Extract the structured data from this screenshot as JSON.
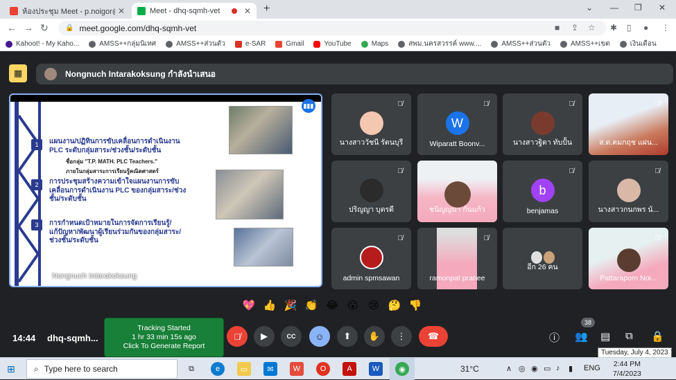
{
  "browser": {
    "tabs": [
      {
        "title": "ห้องประชุม Meet - p.noigor@gmail...",
        "active": false
      },
      {
        "title": "Meet - dhq-sqmh-vet",
        "active": true
      }
    ],
    "new_tab": "+",
    "url": "meet.google.com/dhq-sqmh-vet",
    "bookmarks": [
      "Kahoot! - My Kaho...",
      "AMSS++กลุ่มนิเทศ",
      "AMSS++ส่วนตัว",
      "e-SAR",
      "Gmail",
      "YouTube",
      "Maps",
      "สพม.นครสวรรค์ www....",
      "AMSS++ส่วนตัว",
      "AMSS++เขต",
      "เงินเดือน"
    ]
  },
  "meet": {
    "presenter_banner": "Nongnuch Intarakoksung กำลังนำเสนอ",
    "stage": {
      "name": "Nongnuch Intarakoksung",
      "slide": {
        "items": [
          {
            "num": "1",
            "text_line1": "แผนงาน/ปฏิทินการขับเคลื่อนการดำเนินงาน",
            "text_line2": "PLC ระดับกลุ่มสาระ/ช่วงชั้น/ระดับชั้น"
          },
          {
            "num": "2",
            "text_line1": "การประชุมสร้างความเข้าใจแผนงานการขับ",
            "text_line2": "เคลื่อนการดำเนินงาน PLC ของกลุ่มสาระ/ช่วง",
            "text_line3": "ชั้น/ระดับชั้น"
          },
          {
            "num": "3",
            "text_line1": "การกำหนดเป้าหมายในการจัดการเรียนรู้/",
            "text_line2": "แก้ปัญหา/พัฒนาผู้เรียนร่วมกันของกลุ่มสาระ/",
            "text_line3": "ช่วงชั้น/ระดับชั้น"
          }
        ],
        "sub1": "ชื่อกลุ่ม \"T.P. MATH. PLC Teachers.\"",
        "sub2": "ภายในกลุ่มสาระการเรียนรู้คณิตศาสตร์"
      }
    },
    "participants": [
      {
        "name": "นางสาววัชนี รัตนบุรี",
        "avatar": "photo"
      },
      {
        "name": "Wiparatt Boonv...",
        "avatar": "W",
        "color": "#1a73e8"
      },
      {
        "name": "นางสาวฐิดา ทับปั้น",
        "avatar": "photo"
      },
      {
        "name": "ส.ต.คมกฤช แผ่น...",
        "avatar": "video"
      },
      {
        "name": "ปริญญา บุตรดี",
        "avatar": "photo"
      },
      {
        "name": "ชนิญญนา กันแก้ว",
        "avatar": "video"
      },
      {
        "name": "benjamas",
        "avatar": "b",
        "color": "#a142f4"
      },
      {
        "name": "นางสาวกนกพร นั...",
        "avatar": "photo"
      },
      {
        "name": "admin spmsawan",
        "avatar": "photo"
      },
      {
        "name": "ramonpat pranee",
        "avatar": "video"
      },
      {
        "name": "อีก 26 คน",
        "avatar": "group"
      },
      {
        "name": "Pattaraporn Noi...",
        "avatar": "video"
      }
    ],
    "reactions": [
      "💖",
      "👍",
      "🎉",
      "👏",
      "😂",
      "😮",
      "😢",
      "🤔",
      "👎"
    ],
    "bottom": {
      "time": "14:44",
      "meeting_code": "dhq-sqmh...",
      "tracker_line1": "Tracking Started",
      "tracker_line2": "1 hr 33 min 15s ago",
      "tracker_line3": "Click To Generate Report",
      "people_count": "38",
      "date_tooltip": "Tuesday, July 4, 2023"
    }
  },
  "taskbar": {
    "search_placeholder": "Type here to search",
    "temperature": "31°C",
    "lang": "ENG",
    "clock_time": "2:44 PM",
    "clock_date": "7/4/2023"
  }
}
